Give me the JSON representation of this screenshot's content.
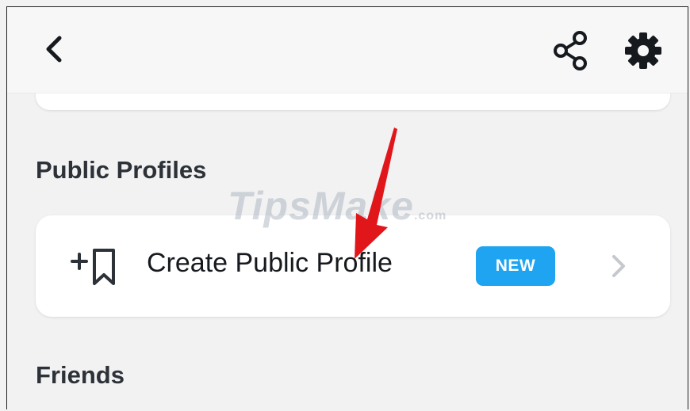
{
  "header": {
    "back_icon": "chevron-left-icon",
    "share_icon": "share-icon",
    "settings_icon": "gear-icon"
  },
  "sections": {
    "public_profiles": {
      "title": "Public Profiles",
      "item": {
        "icon": "add-bookmark-icon",
        "label": "Create Public Profile",
        "badge": "NEW",
        "chevron_icon": "chevron-right-icon"
      }
    },
    "friends": {
      "title": "Friends"
    }
  },
  "watermark": {
    "main": "TipsMake",
    "suffix": ".com"
  },
  "colors": {
    "badge": "#1ea4f0",
    "arrow": "#e0161b",
    "title_text": "#2d3238"
  }
}
